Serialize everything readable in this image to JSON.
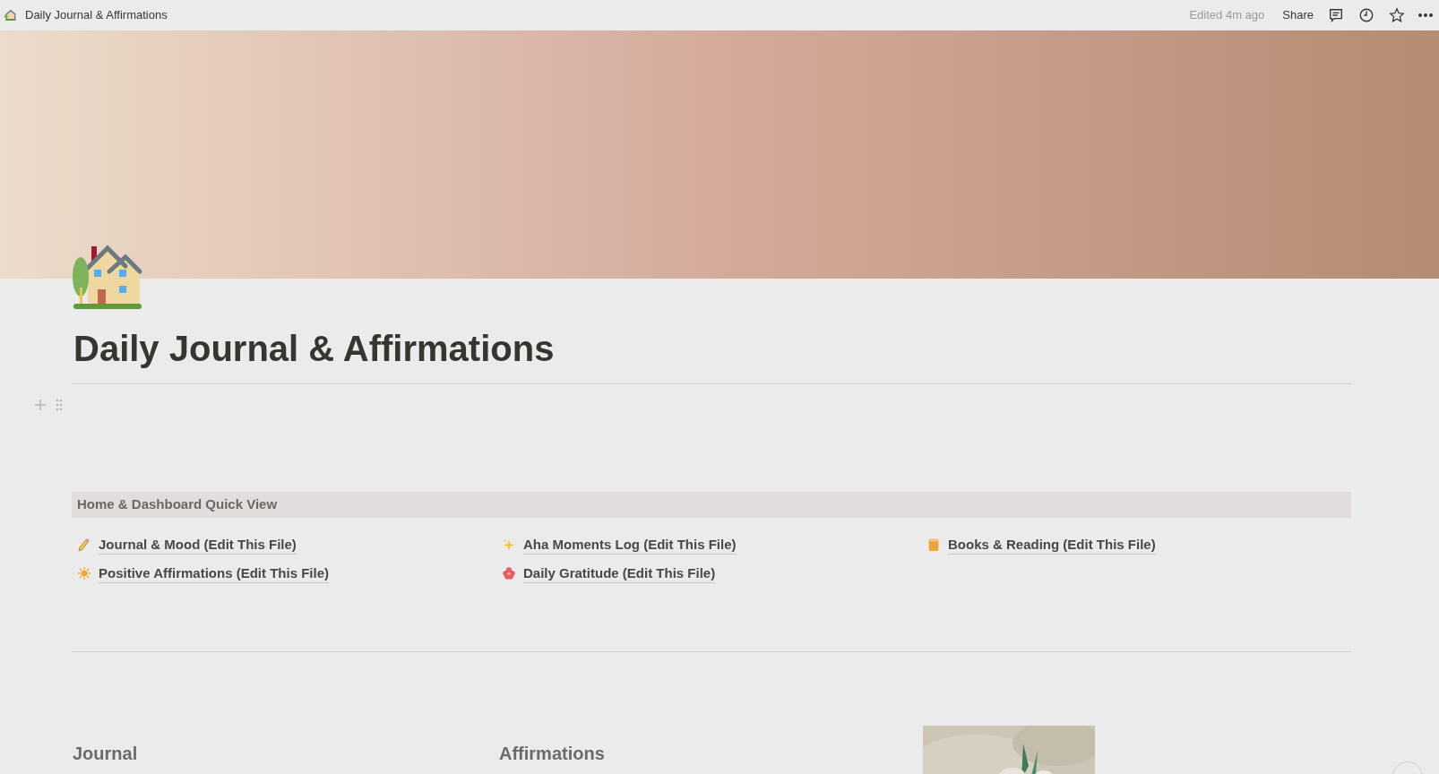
{
  "topbar": {
    "page_title": "Daily Journal & Affirmations",
    "edited": "Edited 4m ago",
    "share": "Share"
  },
  "page": {
    "title": "Daily Journal & Affirmations"
  },
  "callout": {
    "title": "Home & Dashboard Quick View"
  },
  "links": [
    {
      "label": "Journal & Mood (Edit This File)",
      "kind": "pencil"
    },
    {
      "label": "Aha Moments Log (Edit This File)",
      "kind": "sparkles"
    },
    {
      "label": "Books & Reading (Edit This File)",
      "kind": "book"
    },
    {
      "label": "Positive Affirmations (Edit This File)",
      "kind": "sun"
    },
    {
      "label": "Daily Gratitude (Edit This File)",
      "kind": "flower"
    }
  ],
  "columns": [
    {
      "kind": "heading",
      "heading": "Journal"
    },
    {
      "kind": "heading",
      "heading": "Affirmations"
    },
    {
      "kind": "picture"
    }
  ]
}
